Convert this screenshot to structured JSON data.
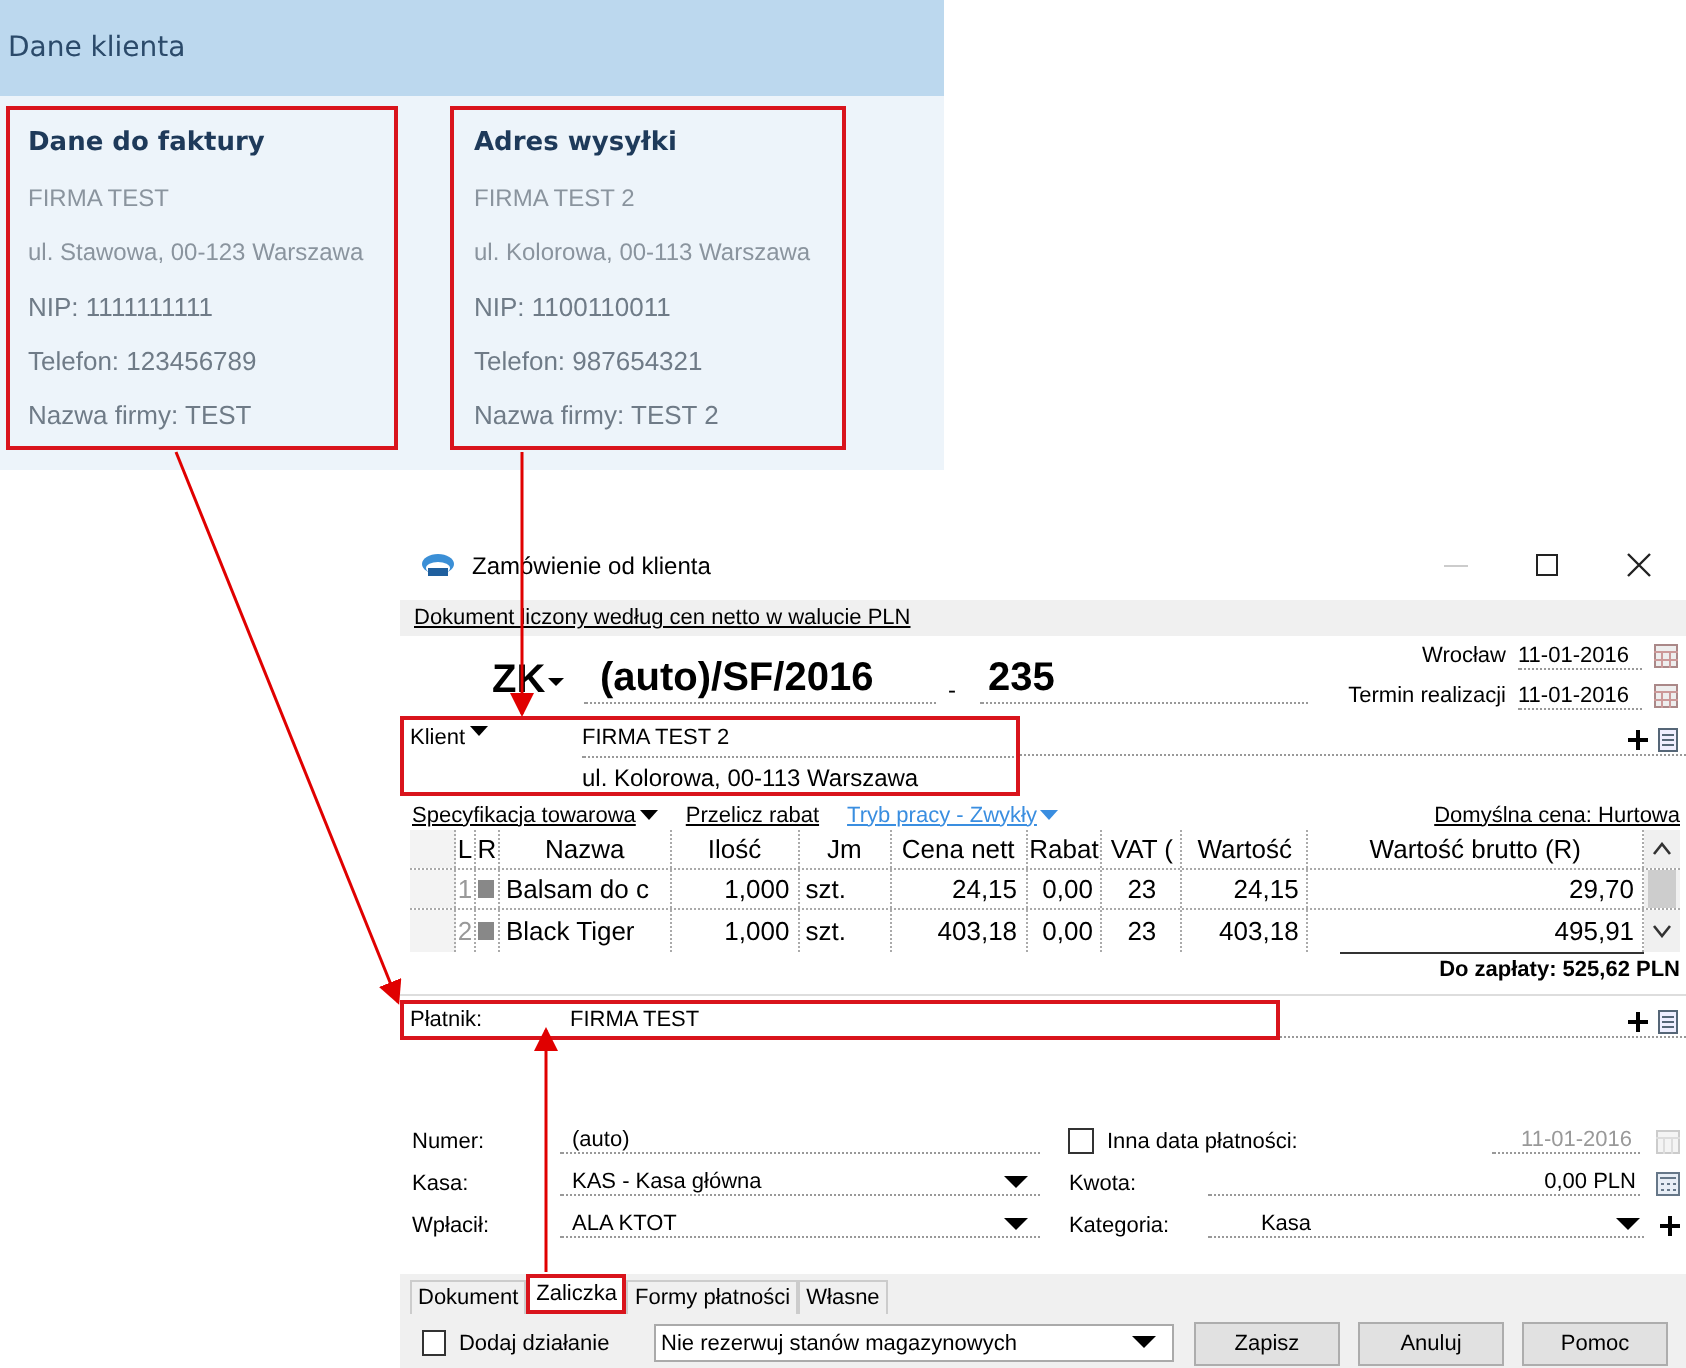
{
  "client_panel": {
    "title": "Dane klienta",
    "cards": [
      {
        "heading": "Dane do faktury",
        "company": "FIRMA TEST",
        "address": "ul. Stawowa, 00-123 Warszawa",
        "fields": [
          {
            "label": "NIP:",
            "value": "1111111111"
          },
          {
            "label": "Telefon:",
            "value": "123456789"
          },
          {
            "label": "Nazwa firmy:",
            "value": "TEST"
          }
        ]
      },
      {
        "heading": "Adres wysyłki",
        "company": "FIRMA TEST 2",
        "address": "ul. Kolorowa, 00-113 Warszawa",
        "fields": [
          {
            "label": "NIP:",
            "value": "1100110011"
          },
          {
            "label": "Telefon:",
            "value": "987654321"
          },
          {
            "label": "Nazwa firmy:",
            "value": "TEST 2"
          }
        ]
      }
    ]
  },
  "window": {
    "title": "Zamówienie od klienta"
  },
  "info_bar": "Dokument liczony według cen netto w walucie PLN",
  "document": {
    "type": "ZK",
    "number": "(auto)/SF/2016",
    "separator": "-",
    "sequence": "235",
    "dates": [
      {
        "label": "Wrocław",
        "value": "11-01-2016"
      },
      {
        "label": "Termin realizacji",
        "value": "11-01-2016"
      }
    ]
  },
  "client": {
    "label": "Klient",
    "name": "FIRMA TEST 2",
    "address": "ul. Kolorowa, 00-113 Warszawa"
  },
  "items_toolbar": {
    "specification": "Specyfikacja towarowa",
    "recalc": "Przelicz rabat",
    "mode": "Tryb pracy - Zwykły",
    "default_price": "Domyślna cena: Hurtowa"
  },
  "table": {
    "columns": [
      "L",
      "R",
      "Nazwa",
      "Ilość",
      "Jm",
      "Cena nett",
      "Rabat",
      "VAT (",
      "Wartość",
      "Wartość brutto (R)"
    ],
    "rows": [
      {
        "lp": "1",
        "values": [
          "Balsam do c",
          "1,000",
          "szt.",
          "24,15",
          "0,00",
          "23",
          "24,15",
          "29,70"
        ]
      },
      {
        "lp": "2",
        "values": [
          "Black Tiger",
          "1,000",
          "szt.",
          "403,18",
          "0,00",
          "23",
          "403,18",
          "495,91"
        ]
      }
    ]
  },
  "total": "Do zapłaty: 525,62 PLN",
  "payer": {
    "label": "Płatnik:",
    "name": "FIRMA TEST"
  },
  "advance": {
    "left": [
      {
        "kind": "text",
        "label": "Numer:",
        "value": "(auto)"
      },
      {
        "kind": "dropdown",
        "label": "Kasa:",
        "value": "KAS - Kasa główna"
      },
      {
        "kind": "dropdown",
        "label": "Wpłacił:",
        "value": "ALA KTOT"
      }
    ],
    "other_date": {
      "label": "Inna data płatności:",
      "checked": false,
      "value": "11-01-2016"
    },
    "amount": {
      "label": "Kwota:",
      "value": "0,00 PLN"
    },
    "category": {
      "label": "Kategoria:",
      "value": "Kasa"
    }
  },
  "tabs": [
    {
      "label": "Dokument",
      "selected": false
    },
    {
      "label": "Zaliczka",
      "selected": true
    },
    {
      "label": "Formy płatności",
      "selected": false
    },
    {
      "label": "Własne",
      "selected": false
    }
  ],
  "footer": {
    "add_action": {
      "label": "Dodaj działanie",
      "checked": false
    },
    "reservation": "Nie rezerwuj stanów magazynowych",
    "buttons": [
      "Zapisz",
      "Anuluj",
      "Pomoc"
    ]
  }
}
